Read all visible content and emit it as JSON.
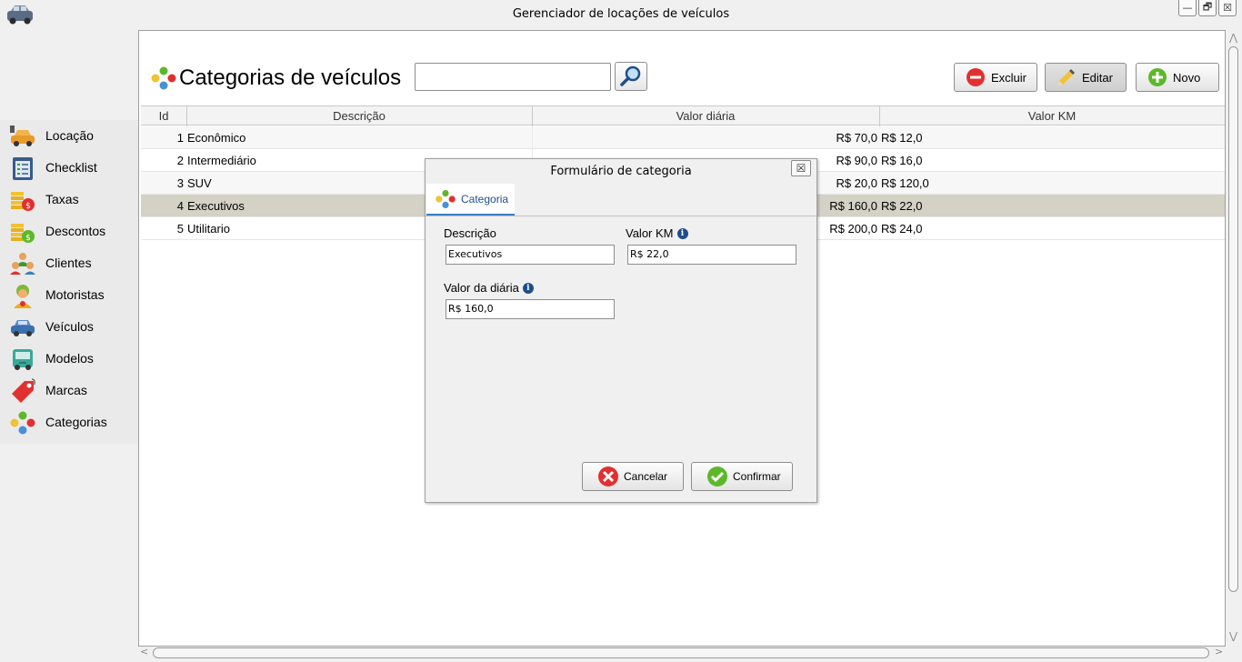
{
  "window": {
    "title": "Gerenciador de locações de veículos",
    "minimize": "—",
    "restore": "🗗",
    "close": "☒"
  },
  "sidebar": {
    "items": [
      {
        "label": "Locação",
        "icon": "car-rental-icon"
      },
      {
        "label": "Checklist",
        "icon": "checklist-icon"
      },
      {
        "label": "Taxas",
        "icon": "coins-tax-icon"
      },
      {
        "label": "Descontos",
        "icon": "coins-discount-icon"
      },
      {
        "label": "Clientes",
        "icon": "people-icon"
      },
      {
        "label": "Motoristas",
        "icon": "driver-icon"
      },
      {
        "label": "Veículos",
        "icon": "car-icon"
      },
      {
        "label": "Modelos",
        "icon": "bus-icon"
      },
      {
        "label": "Marcas",
        "icon": "tag-icon"
      },
      {
        "label": "Categorias",
        "icon": "categories-icon"
      }
    ]
  },
  "header": {
    "title": "Categorias de veículos",
    "search_value": ""
  },
  "toolbar": {
    "delete_label": "Excluir",
    "edit_label": "Editar",
    "new_label": "Novo"
  },
  "table": {
    "columns": [
      "Id",
      "Descrição",
      "Valor diária",
      "Valor KM"
    ],
    "rows": [
      {
        "id": "1",
        "descricao": "Econômico",
        "valor_diaria": "R$ 70,0",
        "valor_km": "R$ 12,0"
      },
      {
        "id": "2",
        "descricao": "Intermediário",
        "valor_diaria": "R$ 90,0",
        "valor_km": "R$ 16,0"
      },
      {
        "id": "3",
        "descricao": "SUV",
        "valor_diaria": "R$ 20,0",
        "valor_km": "R$ 120,0"
      },
      {
        "id": "4",
        "descricao": "Executivos",
        "valor_diaria": "R$ 160,0",
        "valor_km": "R$ 22,0"
      },
      {
        "id": "5",
        "descricao": "Utilitario",
        "valor_diaria": "R$ 200,0",
        "valor_km": "R$ 24,0"
      }
    ],
    "selected_row": 4
  },
  "dialog": {
    "title": "Formulário de categoria",
    "close": "☒",
    "tab_label": "Categoria",
    "descricao_label": "Descrição",
    "descricao_value": "Executivos",
    "valor_km_label": "Valor KM",
    "valor_km_value": "R$ 22,0",
    "valor_diaria_label": "Valor da diária",
    "valor_diaria_value": "R$ 160,0",
    "info_glyph": "i",
    "cancel_label": "Cancelar",
    "confirm_label": "Confirmar"
  },
  "colors": {
    "accent": "#3b7fc4",
    "selected_row": "#d4d1c5",
    "danger": "#e23030",
    "success": "#5cb82a"
  }
}
